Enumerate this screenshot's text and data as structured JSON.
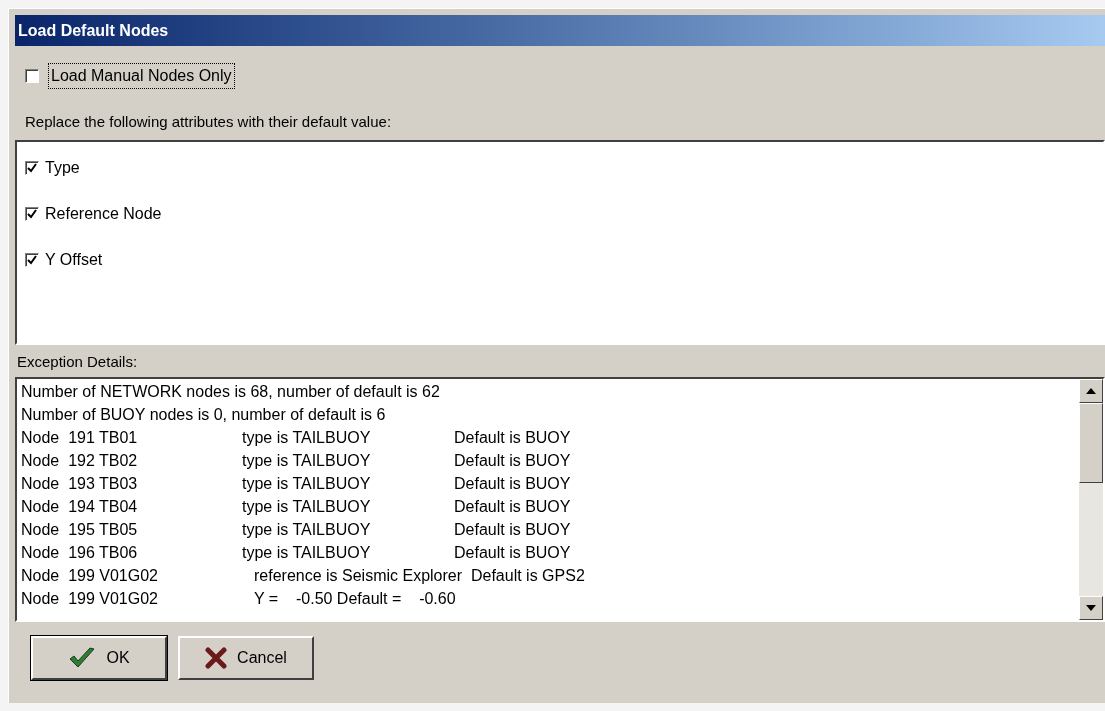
{
  "window": {
    "title": "Load Default Nodes"
  },
  "manual_only": {
    "label": "Load Manual Nodes Only",
    "checked": false
  },
  "attributes_label": "Replace the following attributes with their default value:",
  "attributes": [
    {
      "label": "Type",
      "checked": true
    },
    {
      "label": "Reference Node",
      "checked": true
    },
    {
      "label": "Y Offset",
      "checked": true
    }
  ],
  "exceptions_label": "Exception Details:",
  "exceptions": [
    {
      "kind": "summary",
      "text": "Number of NETWORK nodes is 68, number of default is 62"
    },
    {
      "kind": "summary",
      "text": "Number of BUOY nodes is 0, number of default is 6"
    },
    {
      "kind": "detail",
      "node": "Node  191 TB01",
      "change": "type is TAILBUOY",
      "default": "Default is BUOY"
    },
    {
      "kind": "detail",
      "node": "Node  192 TB02",
      "change": "type is TAILBUOY",
      "default": "Default is BUOY"
    },
    {
      "kind": "detail",
      "node": "Node  193 TB03",
      "change": "type is TAILBUOY",
      "default": "Default is BUOY"
    },
    {
      "kind": "detail",
      "node": "Node  194 TB04",
      "change": "type is TAILBUOY",
      "default": "Default is BUOY"
    },
    {
      "kind": "detail",
      "node": "Node  195 TB05",
      "change": "type is TAILBUOY",
      "default": "Default is BUOY"
    },
    {
      "kind": "detail",
      "node": "Node  196 TB06",
      "change": "type is TAILBUOY",
      "default": "Default is BUOY"
    },
    {
      "kind": "note",
      "node": "Node  199 V01G02",
      "text": "reference is Seismic Explorer  Default is GPS2"
    },
    {
      "kind": "note",
      "node": "Node  199 V01G02",
      "text": "Y =    -0.50 Default =    -0.60"
    }
  ],
  "buttons": [
    {
      "kind": "ok",
      "label": "OK"
    },
    {
      "kind": "cancel",
      "label": "Cancel"
    }
  ]
}
